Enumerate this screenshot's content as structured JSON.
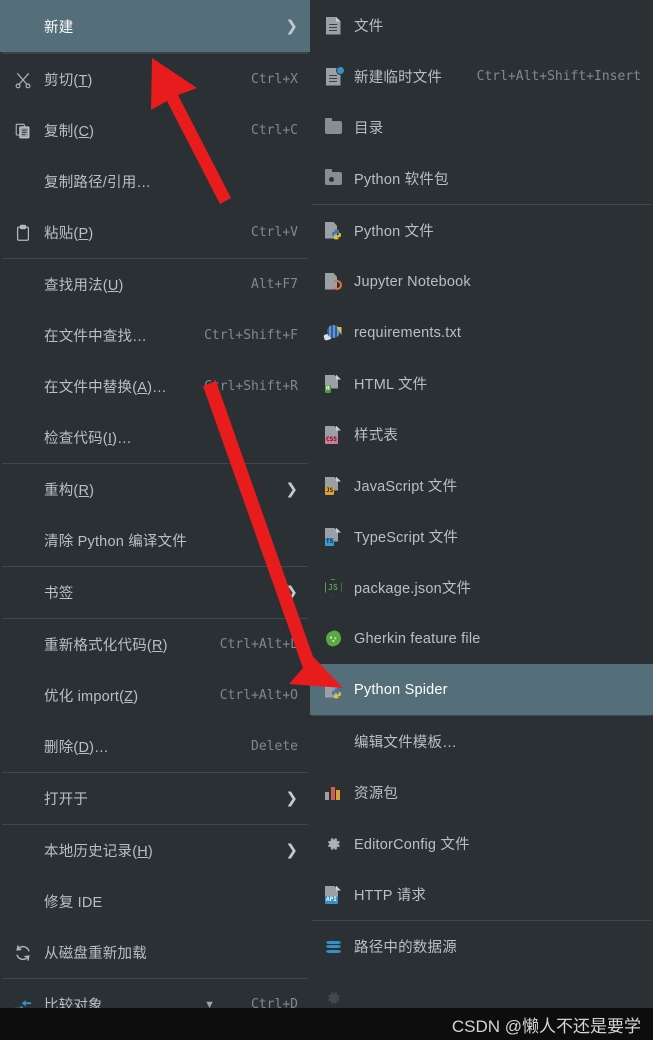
{
  "colors": {
    "background": "#2b3034",
    "selection": "#546e7a",
    "text": "#b9bfc4",
    "accel_text": "#7b8a96",
    "separator": "#41484d",
    "arrow_red": "#e81c1c",
    "accent_blue": "#3592c4",
    "footer_background": "#0d0d0d"
  },
  "context_menu": {
    "name": "editor-context-menu",
    "items": [
      {
        "id": "new",
        "label": "新建",
        "accel": "",
        "icon": "",
        "submenu": true,
        "selected": true,
        "sep_after": true
      },
      {
        "id": "cut",
        "label": "剪切(T)",
        "accel": "Ctrl+X",
        "icon": "scissors-icon",
        "submenu": false,
        "selected": false,
        "sep_after": false
      },
      {
        "id": "copy",
        "label": "复制(C)",
        "accel": "Ctrl+C",
        "icon": "copy-icon",
        "submenu": false,
        "selected": false,
        "sep_after": false
      },
      {
        "id": "copy-path",
        "label": "复制路径/引用…",
        "accel": "",
        "icon": "",
        "submenu": false,
        "selected": false,
        "sep_after": false
      },
      {
        "id": "paste",
        "label": "粘贴(P)",
        "accel": "Ctrl+V",
        "icon": "clipboard-icon",
        "submenu": false,
        "selected": false,
        "sep_after": true
      },
      {
        "id": "find-usages",
        "label": "查找用法(U)",
        "accel": "Alt+F7",
        "icon": "",
        "submenu": false,
        "selected": false,
        "sep_after": false
      },
      {
        "id": "find-in-files",
        "label": "在文件中查找…",
        "accel": "Ctrl+Shift+F",
        "icon": "",
        "submenu": false,
        "selected": false,
        "sep_after": false
      },
      {
        "id": "replace-in-files",
        "label": "在文件中替换(A)…",
        "accel": "Ctrl+Shift+R",
        "icon": "",
        "submenu": false,
        "selected": false,
        "sep_after": false
      },
      {
        "id": "inspect-code",
        "label": "检查代码(I)…",
        "accel": "",
        "icon": "",
        "submenu": false,
        "selected": false,
        "sep_after": true
      },
      {
        "id": "refactor",
        "label": "重构(R)",
        "accel": "",
        "icon": "",
        "submenu": true,
        "selected": false,
        "sep_after": false
      },
      {
        "id": "clean-pyc",
        "label": "清除 Python 编译文件",
        "accel": "",
        "icon": "",
        "submenu": false,
        "selected": false,
        "sep_after": true
      },
      {
        "id": "bookmarks",
        "label": "书签",
        "accel": "",
        "icon": "",
        "submenu": true,
        "selected": false,
        "sep_after": true
      },
      {
        "id": "reformat-code",
        "label": "重新格式化代码(R)",
        "accel": "Ctrl+Alt+L",
        "icon": "",
        "submenu": false,
        "selected": false,
        "sep_after": false
      },
      {
        "id": "optimize-imports",
        "label": "优化 import(Z)",
        "accel": "Ctrl+Alt+O",
        "icon": "",
        "submenu": false,
        "selected": false,
        "sep_after": false
      },
      {
        "id": "delete",
        "label": "删除(D)…",
        "accel": "Delete",
        "icon": "",
        "submenu": false,
        "selected": false,
        "sep_after": true
      },
      {
        "id": "open-in",
        "label": "打开于",
        "accel": "",
        "icon": "",
        "submenu": true,
        "selected": false,
        "sep_after": true
      },
      {
        "id": "local-history",
        "label": "本地历史记录(H)",
        "accel": "",
        "icon": "",
        "submenu": true,
        "selected": false,
        "sep_after": false
      },
      {
        "id": "repair-ide",
        "label": "修复 IDE",
        "accel": "",
        "icon": "",
        "submenu": false,
        "selected": false,
        "sep_after": false
      },
      {
        "id": "reload-from-disk",
        "label": "从磁盘重新加载",
        "accel": "",
        "icon": "refresh-icon",
        "submenu": false,
        "selected": false,
        "sep_after": true
      },
      {
        "id": "compare-with",
        "label": "比较对象…",
        "accel": "Ctrl+D",
        "icon": "compare-icon",
        "submenu": false,
        "selected": false,
        "sep_after": false,
        "has_caret": true
      }
    ]
  },
  "new_submenu": {
    "name": "new-file-submenu",
    "items": [
      {
        "id": "file",
        "label": "文件",
        "accel": "",
        "icon": "file-icon",
        "selected": false,
        "sep_after": false
      },
      {
        "id": "scratch-file",
        "label": "新建临时文件",
        "accel": "Ctrl+Alt+Shift+Insert",
        "icon": "scratch-file-icon",
        "selected": false,
        "sep_after": false
      },
      {
        "id": "directory",
        "label": "目录",
        "accel": "",
        "icon": "folder-icon",
        "selected": false,
        "sep_after": false
      },
      {
        "id": "python-package",
        "label": "Python 软件包",
        "accel": "",
        "icon": "python-package-icon",
        "selected": false,
        "sep_after": true
      },
      {
        "id": "python-file",
        "label": "Python 文件",
        "accel": "",
        "icon": "python-file-icon",
        "selected": false,
        "sep_after": false
      },
      {
        "id": "jupyter",
        "label": "Jupyter Notebook",
        "accel": "",
        "icon": "jupyter-icon",
        "selected": false,
        "sep_after": false
      },
      {
        "id": "requirements",
        "label": "requirements.txt",
        "accel": "",
        "icon": "requirements-icon",
        "selected": false,
        "sep_after": false
      },
      {
        "id": "html-file",
        "label": "HTML 文件",
        "accel": "",
        "icon": "html-file-icon",
        "selected": false,
        "sep_after": false
      },
      {
        "id": "stylesheet",
        "label": "样式表",
        "accel": "",
        "icon": "css-file-icon",
        "selected": false,
        "sep_after": false
      },
      {
        "id": "javascript-file",
        "label": "JavaScript 文件",
        "accel": "",
        "icon": "js-file-icon",
        "selected": false,
        "sep_after": false
      },
      {
        "id": "typescript-file",
        "label": "TypeScript 文件",
        "accel": "",
        "icon": "ts-file-icon",
        "selected": false,
        "sep_after": false
      },
      {
        "id": "package-json",
        "label": "package.json文件",
        "accel": "",
        "icon": "nodejs-icon",
        "selected": false,
        "sep_after": false
      },
      {
        "id": "gherkin",
        "label": "Gherkin feature file",
        "accel": "",
        "icon": "cucumber-icon",
        "selected": false,
        "sep_after": false
      },
      {
        "id": "python-spider",
        "label": "Python Spider",
        "accel": "",
        "icon": "python-file-icon",
        "selected": true,
        "sep_after": true
      },
      {
        "id": "edit-templates",
        "label": "编辑文件模板…",
        "accel": "",
        "icon": "",
        "selected": false,
        "sep_after": false
      },
      {
        "id": "resource-bundle",
        "label": "资源包",
        "accel": "",
        "icon": "resource-bundle-icon",
        "selected": false,
        "sep_after": false
      },
      {
        "id": "editorconfig",
        "label": "EditorConfig 文件",
        "accel": "",
        "icon": "gear-icon",
        "selected": false,
        "sep_after": false
      },
      {
        "id": "http-request",
        "label": "HTTP 请求",
        "accel": "",
        "icon": "http-request-icon",
        "selected": false,
        "sep_after": true
      },
      {
        "id": "data-source",
        "label": "路径中的数据源",
        "accel": "",
        "icon": "database-icon",
        "selected": false,
        "sep_after": false
      }
    ]
  },
  "footer": {
    "watermark": "CSDN @懒人不还是要学"
  }
}
